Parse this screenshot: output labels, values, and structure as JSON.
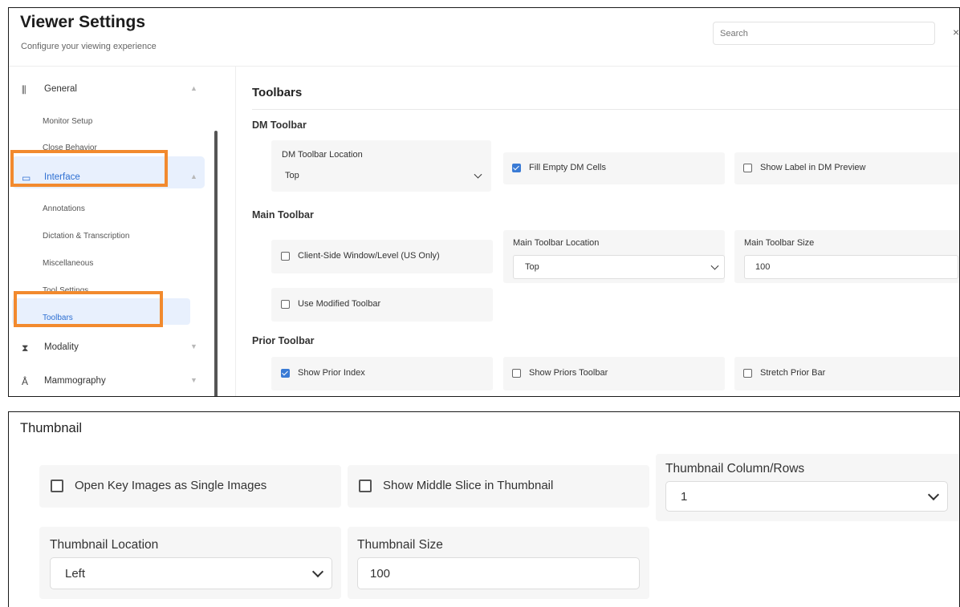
{
  "header": {
    "title": "Viewer Settings",
    "subtitle": "Configure your viewing experience",
    "search_placeholder": "Search",
    "close_glyph": "×"
  },
  "highlight_color": "#f28a2e",
  "accent_color": "#3a7bd5",
  "sidebar": {
    "groups": [
      {
        "label": "General",
        "icon": "sliders-icon",
        "glyph": "⫼",
        "expanded": true,
        "items": [
          "Monitor Setup",
          "Close Behavior"
        ]
      },
      {
        "label": "Interface",
        "icon": "monitor-icon",
        "glyph": "▭",
        "expanded": true,
        "active": true,
        "items": [
          "Annotations",
          "Dictation & Transcription",
          "Miscellaneous",
          "Tool Settings",
          "Toolbars"
        ]
      },
      {
        "label": "Modality",
        "icon": "modality-icon",
        "glyph": "⧗",
        "expanded": false
      },
      {
        "label": "Mammography",
        "icon": "mammography-icon",
        "glyph": "Å",
        "expanded": false
      }
    ],
    "selected_item": "Toolbars"
  },
  "toolbars": {
    "title": "Toolbars",
    "dm": {
      "heading": "DM Toolbar",
      "location_label": "DM Toolbar Location",
      "location_value": "Top",
      "fill_empty_label": "Fill Empty DM Cells",
      "fill_empty_checked": true,
      "show_label_label": "Show Label in DM Preview",
      "show_label_checked": false
    },
    "main": {
      "heading": "Main Toolbar",
      "client_side_label": "Client-Side Window/Level (US Only)",
      "client_side_checked": false,
      "location_label": "Main Toolbar Location",
      "location_value": "Top",
      "size_label": "Main Toolbar Size",
      "size_value": "100",
      "modified_label": "Use Modified Toolbar",
      "modified_checked": false
    },
    "prior": {
      "heading": "Prior Toolbar",
      "show_index_label": "Show Prior Index",
      "show_index_checked": true,
      "show_priors_label": "Show Priors Toolbar",
      "show_priors_checked": false,
      "stretch_label": "Stretch Prior Bar",
      "stretch_checked": false
    }
  },
  "thumbnail": {
    "title": "Thumbnail",
    "open_key_label": "Open Key Images as Single Images",
    "open_key_checked": false,
    "middle_slice_label": "Show Middle Slice in Thumbnail",
    "middle_slice_checked": false,
    "colrows_label": "Thumbnail Column/Rows",
    "colrows_value": "1",
    "location_label": "Thumbnail Location",
    "location_value": "Left",
    "size_label": "Thumbnail Size",
    "size_value": "100"
  }
}
